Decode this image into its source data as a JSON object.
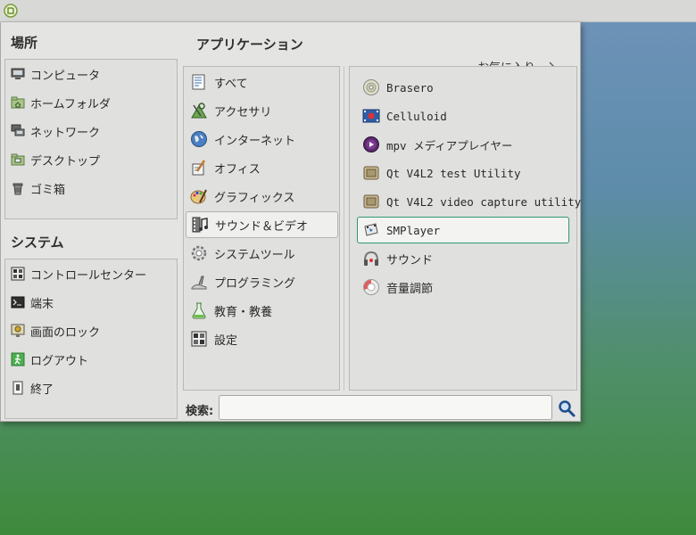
{
  "places": {
    "title": "場所",
    "items": [
      {
        "label": "コンピュータ",
        "icon": "computer-icon"
      },
      {
        "label": "ホームフォルダ",
        "icon": "home-folder-icon"
      },
      {
        "label": "ネットワーク",
        "icon": "network-icon"
      },
      {
        "label": "デスクトップ",
        "icon": "desktop-folder-icon"
      },
      {
        "label": "ゴミ箱",
        "icon": "trash-icon"
      }
    ]
  },
  "system": {
    "title": "システム",
    "items": [
      {
        "label": "コントロールセンター",
        "icon": "control-center-icon"
      },
      {
        "label": "端末",
        "icon": "terminal-icon"
      },
      {
        "label": "画面のロック",
        "icon": "lock-screen-icon"
      },
      {
        "label": "ログアウト",
        "icon": "logout-icon"
      },
      {
        "label": "終了",
        "icon": "shutdown-icon"
      }
    ]
  },
  "applications": {
    "title": "アプリケーション",
    "favorites_label": "お気に入り",
    "categories": [
      {
        "label": "すべて",
        "icon": "all-apps-icon"
      },
      {
        "label": "アクセサリ",
        "icon": "accessories-icon"
      },
      {
        "label": "インターネット",
        "icon": "internet-globe-icon"
      },
      {
        "label": "オフィス",
        "icon": "office-icon"
      },
      {
        "label": "グラフィックス",
        "icon": "graphics-palette-icon"
      },
      {
        "label": "サウンド＆ビデオ",
        "icon": "sound-video-icon"
      },
      {
        "label": "システムツール",
        "icon": "system-tools-gear-icon"
      },
      {
        "label": "プログラミング",
        "icon": "programming-icon"
      },
      {
        "label": "教育・教養",
        "icon": "education-flask-icon"
      },
      {
        "label": "設定",
        "icon": "settings-icon"
      }
    ],
    "selected_category": "サウンド＆ビデオ",
    "apps": [
      {
        "label": "Brasero",
        "icon": "brasero-disc-icon"
      },
      {
        "label": "Celluloid",
        "icon": "celluloid-film-icon"
      },
      {
        "label": "mpv メディアプレイヤー",
        "icon": "mpv-icon"
      },
      {
        "label": "Qt V4L2 test Utility",
        "icon": "qv4l2-icon"
      },
      {
        "label": "Qt V4L2 video capture utility",
        "icon": "qvidcap-icon"
      },
      {
        "label": "SMPlayer",
        "icon": "smplayer-icon"
      },
      {
        "label": "サウンド",
        "icon": "sound-headphones-icon"
      },
      {
        "label": "音量調節",
        "icon": "volume-control-icon"
      }
    ],
    "selected_app": "SMPlayer"
  },
  "search": {
    "label": "検索:",
    "value": ""
  },
  "colors": {
    "accent": "#2f9a6e",
    "menu_bg": "#e4e4e2"
  }
}
